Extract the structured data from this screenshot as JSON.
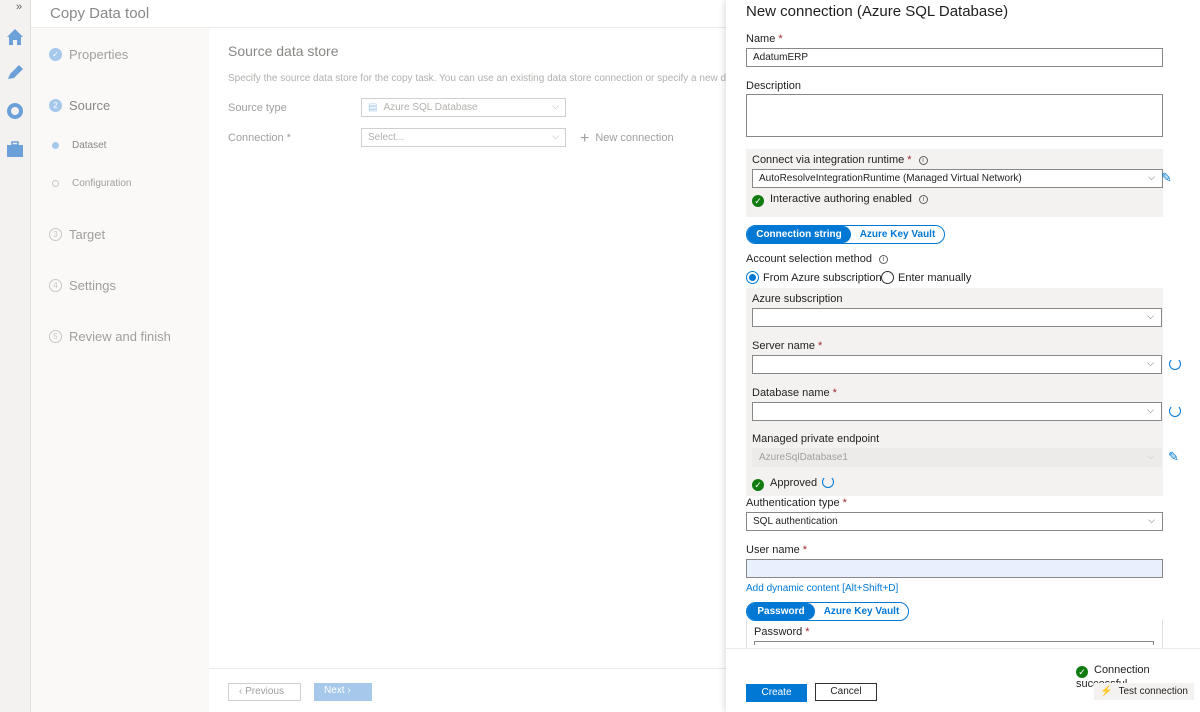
{
  "background": {
    "app_title": "Copy Data tool",
    "steps": [
      {
        "number": "1",
        "label": "Properties",
        "state": "done"
      },
      {
        "number": "2",
        "label": "Source",
        "state": "current"
      },
      {
        "number": "3",
        "label": "Target",
        "state": "pending"
      },
      {
        "number": "4",
        "label": "Settings",
        "state": "pending"
      },
      {
        "number": "5",
        "label": "Review and finish",
        "state": "pending"
      }
    ],
    "substeps": [
      {
        "label": "Dataset",
        "state": "current"
      },
      {
        "label": "Configuration",
        "state": "pending"
      }
    ],
    "main_title": "Source data store",
    "description": "Specify the source data store for the copy task. You can use an existing data store connection or specify a new d",
    "source_type_label": "Source type",
    "source_type_value": "Azure SQL Database",
    "connection_label": "Connection",
    "connection_placeholder": "Select...",
    "new_connection": "New connection",
    "previous": "Previous",
    "next": "Next"
  },
  "panel": {
    "title": "New connection (Azure SQL Database)",
    "name_label": "Name",
    "name_value": "AdatumERP",
    "description_label": "Description",
    "description_value": "",
    "runtime_label": "Connect via integration runtime",
    "runtime_value": "AutoResolveIntegrationRuntime (Managed Virtual Network)",
    "interactive_authoring": "Interactive authoring enabled",
    "tab_connection_string": "Connection string",
    "tab_key_vault": "Azure Key Vault",
    "account_selection_label": "Account selection method",
    "radio_from_subscription": "From Azure subscription",
    "radio_enter_manually": "Enter manually",
    "subscription_label": "Azure subscription",
    "subscription_value": "",
    "server_label": "Server name",
    "server_value": "",
    "database_label": "Database name",
    "database_value": "",
    "private_endpoint_label": "Managed private endpoint",
    "private_endpoint_value": "AzureSqlDatabase1",
    "approved": "Approved",
    "auth_type_label": "Authentication type",
    "auth_type_value": "SQL authentication",
    "username_label": "User name",
    "username_value": "",
    "dynamic_content": "Add dynamic content [Alt+Shift+D]",
    "tab_password": "Password",
    "tab_password_key_vault": "Azure Key Vault",
    "password_label": "Password",
    "connection_status": "Connection successful",
    "create": "Create",
    "cancel": "Cancel",
    "test_connection": "Test connection"
  },
  "colors": {
    "accent": "#0078d4",
    "success": "#107c10",
    "required": "#a4262c"
  }
}
